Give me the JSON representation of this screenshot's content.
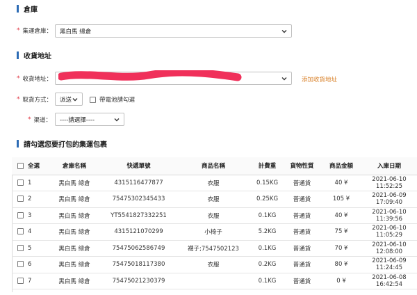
{
  "warehouse_section": {
    "title": "倉庫"
  },
  "warehouse_field": {
    "label": "集運倉庫：",
    "value": "黑白馬 總倉"
  },
  "address_section": {
    "title": "收貨地址"
  },
  "address_field": {
    "label": "收貨地址：",
    "add_link": "添加收貨地址"
  },
  "pickup_field": {
    "label": "取貨方式：",
    "value": "派送",
    "battery_label": "帶電池請勾選"
  },
  "channel_field": {
    "label": "渠道：",
    "value": "----請選擇----"
  },
  "packages_section": {
    "title": "請勾選您要打包的集運包裹"
  },
  "table": {
    "headers": [
      "全選",
      "倉庫名稱",
      "快遞單號",
      "商品名稱",
      "計費重",
      "貨物性質",
      "商品金額",
      "入庫日期"
    ],
    "rows": [
      {
        "no": "1",
        "warehouse": "黑白馬 總倉",
        "tracking": "4315116477877",
        "product": "衣服",
        "weight": "0.15KG",
        "nature": "普通貨",
        "amount": "40 ¥",
        "date": "2021-06-10 11:52:25"
      },
      {
        "no": "2",
        "warehouse": "黑白馬 總倉",
        "tracking": "75475302345433",
        "product": "衣服",
        "weight": "0.25KG",
        "nature": "普通貨",
        "amount": "105 ¥",
        "date": "2021-06-09 17:09:40"
      },
      {
        "no": "3",
        "warehouse": "黑白馬 總倉",
        "tracking": "YT5541827332251",
        "product": "衣服",
        "weight": "0.1KG",
        "nature": "普通貨",
        "amount": "40 ¥",
        "date": "2021-06-10 11:39:56"
      },
      {
        "no": "4",
        "warehouse": "黑白馬 總倉",
        "tracking": "4315121070299",
        "product": "小椅子",
        "weight": "5.2KG",
        "nature": "普通貨",
        "amount": "75 ¥",
        "date": "2021-06-10 11:05:29"
      },
      {
        "no": "5",
        "warehouse": "黑白馬 總倉",
        "tracking": "75475062586749",
        "product": "襪子;7547502123",
        "weight": "0.1KG",
        "nature": "普通貨",
        "amount": "70 ¥",
        "date": "2021-06-10 12:08:00"
      },
      {
        "no": "6",
        "warehouse": "黑白馬 總倉",
        "tracking": "75475018117380",
        "product": "衣服",
        "weight": "0.2KG",
        "nature": "普通貨",
        "amount": "80 ¥",
        "date": "2021-06-09 11:24:45"
      },
      {
        "no": "7",
        "warehouse": "黑白馬 總倉",
        "tracking": "75475021230379",
        "product": "",
        "weight": "0.1KG",
        "nature": "普通貨",
        "amount": "0 ¥",
        "date": "2021-06-08 16:42:54"
      }
    ]
  },
  "colors": {
    "accent": "#2d6cb5",
    "required": "#e0303e",
    "link": "#d9822b",
    "redaction": "#f0305a"
  }
}
